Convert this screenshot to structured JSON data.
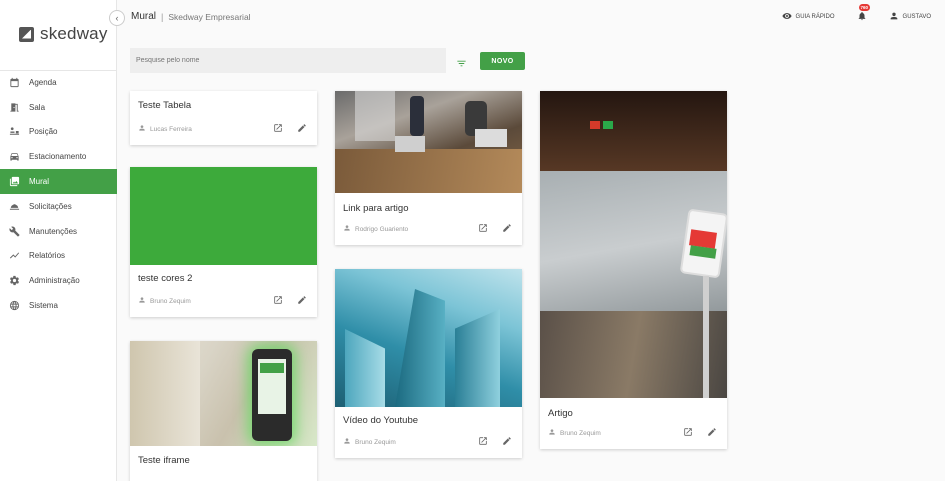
{
  "app": {
    "logo_text": "skedway"
  },
  "header": {
    "breadcrumb_main": "Mural",
    "breadcrumb_sep": "|",
    "breadcrumb_sub": "Skedway Empresarial",
    "quick_guide": "GUIA RÁPIDO",
    "notification_count": "760",
    "user": "GUSTAVO"
  },
  "sidebar": {
    "items": [
      {
        "label": "Agenda",
        "icon": "calendar-icon"
      },
      {
        "label": "Sala",
        "icon": "door-icon"
      },
      {
        "label": "Posição",
        "icon": "desk-icon"
      },
      {
        "label": "Estacionamento",
        "icon": "car-icon"
      },
      {
        "label": "Mural",
        "icon": "photo-icon",
        "active": true
      },
      {
        "label": "Solicitações",
        "icon": "bell-service-icon"
      },
      {
        "label": "Manutenções",
        "icon": "wrench-icon"
      },
      {
        "label": "Relatórios",
        "icon": "trend-icon"
      },
      {
        "label": "Administração",
        "icon": "gear-icon"
      },
      {
        "label": "Sistema",
        "icon": "globe-icon"
      }
    ]
  },
  "search": {
    "placeholder": "Pesquise pelo nome"
  },
  "toolbar": {
    "new_label": "NOVO"
  },
  "colors": {
    "accent": "#43a047",
    "badge": "#e53935"
  },
  "cards": [
    {
      "title": "Teste Tabela",
      "author": "Lucas Ferreira"
    },
    {
      "title": "teste cores 2",
      "author": "Bruno Zequim"
    },
    {
      "title": "Teste iframe",
      "author": ""
    },
    {
      "title": "Link para artigo",
      "author": "Rodrigo Guariento"
    },
    {
      "title": "Vídeo do Youtube",
      "author": "Bruno Zequim"
    },
    {
      "title": "Artigo",
      "author": "Bruno Zequim"
    }
  ]
}
